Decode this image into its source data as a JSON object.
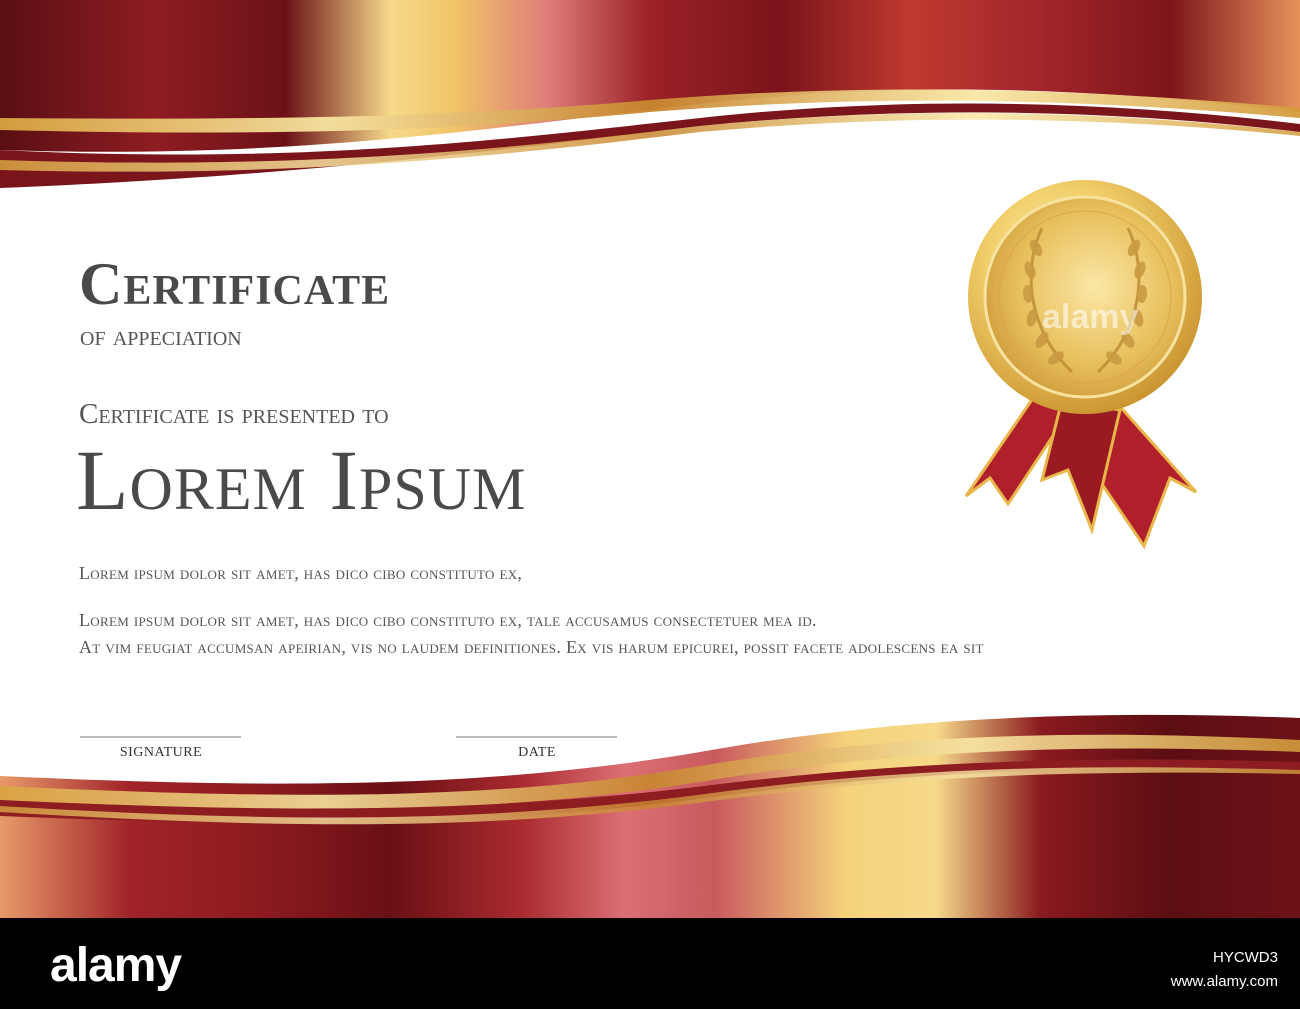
{
  "certificate": {
    "title": "Certificate",
    "subtitle": "of appeciation",
    "presented_to": "Certificate is presented to",
    "recipient_name": "Lorem Ipsum",
    "body_line_1": "Lorem ipsum dolor sit amet, has dico cibo constituto ex,",
    "body_line_2": "Lorem ipsum dolor sit amet, has dico cibo constituto ex, tale accusamus consectetuer mea id.",
    "body_line_3": "At vim feugiat accumsan apeirian, vis no laudem definitiones. Ex vis harum epicurei, possit facete adolescens ea sit",
    "signature_label": "SIGNATURE",
    "date_label": "DATE"
  },
  "medal": {
    "icon": "gold-medal-icon",
    "ribbon_color": "#b0202a",
    "gold_color": "#e8c45a"
  },
  "watermark": {
    "brand": "alamy",
    "overlay": "alamy",
    "id_line": "HYCWD3",
    "url_line": "www.alamy.com"
  },
  "colors": {
    "ribbon_dark": "#6e1218",
    "ribbon_red": "#a8242a",
    "ribbon_pink": "#d86a6e",
    "gold": "#f4d27a",
    "text": "#4d4d4d"
  }
}
